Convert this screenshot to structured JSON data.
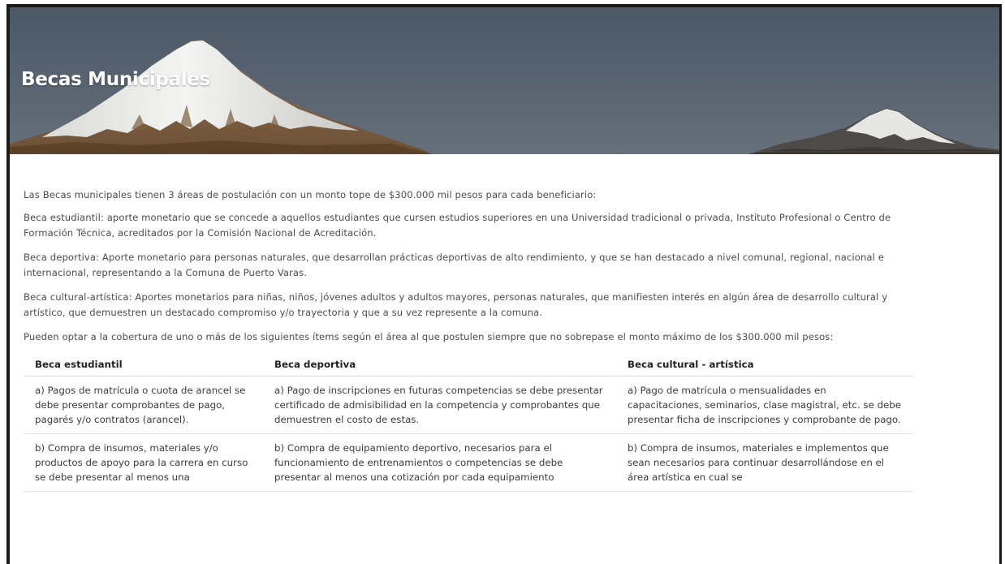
{
  "hero": {
    "title": "Becas Municipales"
  },
  "intro": "Las Becas municipales tienen 3 áreas de postulación con un monto tope de $300.000 mil pesos para cada beneficiario:",
  "paragraphs": [
    "Beca estudiantil: aporte monetario que se concede a aquellos estudiantes que cursen estudios superiores en una Universidad tradicional o privada, Instituto Profesional o Centro de Formación Técnica, acreditados por la Comisión Nacional de Acreditación.",
    "Beca deportiva: Aporte monetario para personas naturales, que desarrollan prácticas deportivas de alto rendimiento, y que se han destacado a nivel comunal, regional, nacional e internacional, representando a la Comuna de Puerto Varas.",
    "Beca cultural-artística: Aportes monetarios para niñas, niños, jóvenes adultos y adultos mayores, personas naturales, que manifiesten interés en algún área de desarrollo cultural y artístico, que demuestren un destacado compromiso y/o trayectoria y que a su vez represente a la comuna.",
    "Pueden optar a la cobertura de uno o más de los siguientes ítems según el área al que postulen siempre que no sobrepase el monto máximo de los $300.000 mil pesos:"
  ],
  "table": {
    "headers": [
      "Beca estudiantil",
      "Beca deportiva",
      "Beca cultural - artística"
    ],
    "rows": [
      [
        "a) Pagos de matrícula o cuota de arancel se debe presentar comprobantes de pago, pagarés y/o contratos (arancel).",
        "a) Pago de inscripciones en futuras competencias se debe presentar certificado de admisibilidad en la competencia y comprobantes que demuestren el costo de estas.",
        "a) Pago de matrícula o mensualidades en capacitaciones, seminarios, clase magistral, etc. se debe presentar ficha de inscripciones y comprobante de pago."
      ],
      [
        "b) Compra de insumos, materiales y/o productos de apoyo para la carrera en curso se debe presentar al menos una",
        "b) Compra de equipamiento deportivo, necesarios para el funcionamiento de entrenamientos o competencias se debe presentar al menos una cotización por cada equipamiento",
        "b) Compra de insumos, materiales e implementos que sean necesarios para continuar desarrollándose en el área artística en cual se"
      ]
    ]
  },
  "colors": {
    "sky": "#56616f",
    "snow": "#f2f2f0",
    "rock": "#8a6a4a",
    "title": "#ffffff",
    "body_text": "#4d4d4d"
  }
}
